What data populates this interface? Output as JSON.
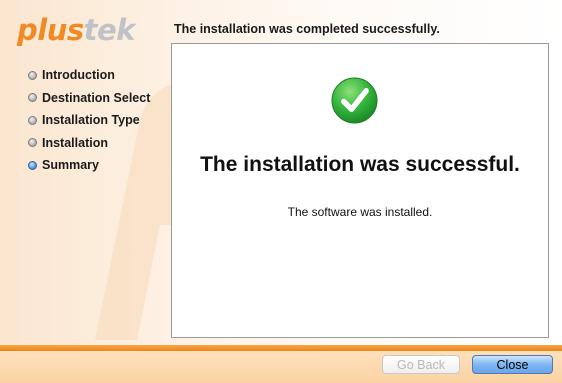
{
  "logo": {
    "part1": "plus",
    "part2": "tek"
  },
  "header": {
    "title": "The installation was completed successfully."
  },
  "steps": [
    {
      "label": "Introduction",
      "active": false
    },
    {
      "label": "Destination Select",
      "active": false
    },
    {
      "label": "Installation Type",
      "active": false
    },
    {
      "label": "Installation",
      "active": false
    },
    {
      "label": "Summary",
      "active": true
    }
  ],
  "content": {
    "icon": "success-check-icon",
    "title": "The installation was successful.",
    "message": "The software was installed."
  },
  "buttons": {
    "back_label": "Go Back",
    "close_label": "Close"
  },
  "colors": {
    "accent_orange": "#f08a24",
    "success_green": "#32b33c",
    "default_button_blue": "#7fb6f2"
  }
}
